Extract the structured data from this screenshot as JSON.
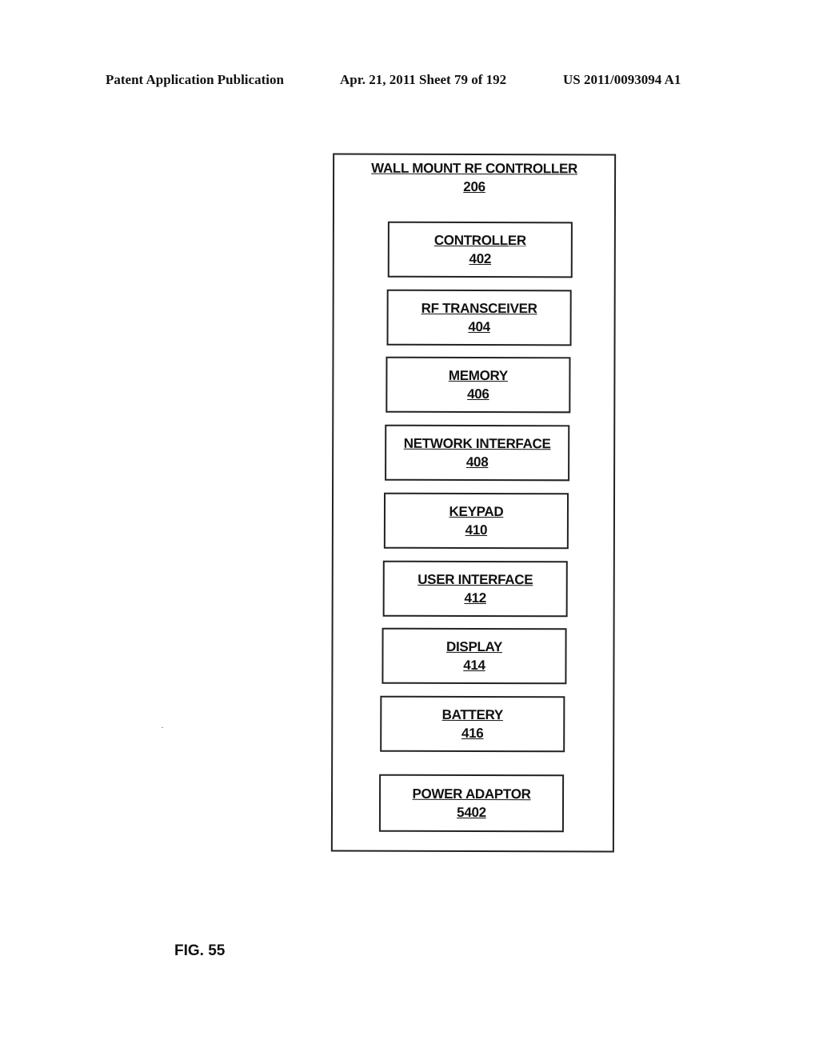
{
  "header": {
    "publication": "Patent Application Publication",
    "date_sheet": "Apr. 21, 2011  Sheet 79 of 192",
    "number": "US 2011/0093094 A1"
  },
  "diagram": {
    "container": {
      "label": "WALL MOUNT RF CONTROLLER",
      "ref": "206"
    },
    "blocks": [
      {
        "label": "CONTROLLER",
        "ref": "402"
      },
      {
        "label": "RF TRANSCEIVER",
        "ref": "404"
      },
      {
        "label": "MEMORY",
        "ref": "406"
      },
      {
        "label": "NETWORK INTERFACE",
        "ref": "408"
      },
      {
        "label": "KEYPAD",
        "ref": "410"
      },
      {
        "label": "USER INTERFACE",
        "ref": "412"
      },
      {
        "label": "DISPLAY",
        "ref": "414"
      },
      {
        "label": "BATTERY",
        "ref": "416"
      },
      {
        "label": "POWER ADAPTOR",
        "ref": "5402"
      }
    ]
  },
  "figure_label": "FIG. 55"
}
